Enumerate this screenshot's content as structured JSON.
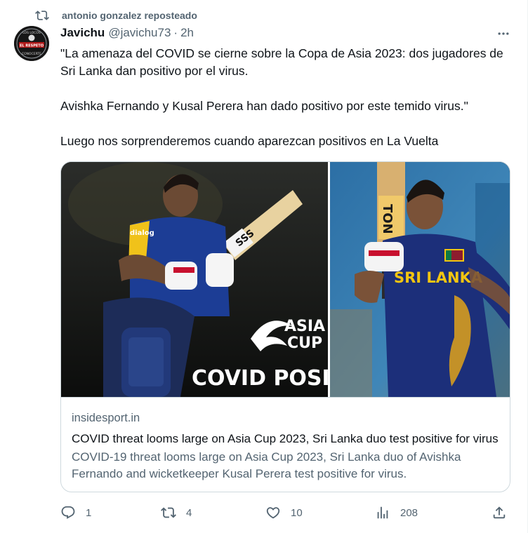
{
  "repost": {
    "label": "antonio gonzalez reposteado"
  },
  "author": {
    "name": "Javichu",
    "handle": "@javichu73",
    "separator": "·",
    "time": "2h"
  },
  "avatar_text": {
    "top": "LOS LOCOS",
    "middle": "EL RESPETO",
    "bottom": "CONOCERTE"
  },
  "tweet": {
    "lines": [
      "\"La amenaza del COVID se cierne sobre la Copa de Asia 2023: dos jugadores de Sri Lanka dan positivo por el virus.",
      "Avishka Fernando y Kusal Perera han dado positivo por este temido virus.\"",
      "Luego nos sorprenderemos cuando aparezcan positivos en La Vuelta"
    ]
  },
  "card": {
    "image_text": {
      "logo_line1": "ASIA",
      "logo_line2": "CUP",
      "banner": "COVID POSITIVE",
      "jersey_left": "SSS",
      "jersey_right": "SRI LANKA",
      "bat_text": "TON",
      "sponsor": "dialog"
    },
    "domain": "insidesport.in",
    "title": "COVID threat looms large on Asia Cup 2023, Sri Lanka duo test positive for virus",
    "description": "COVID-19 threat looms large on Asia Cup 2023, Sri Lanka duo of Avishka Fernando and wicketkeeper Kusal Perera test positive for virus."
  },
  "actions": {
    "replies": "1",
    "reposts": "4",
    "likes": "10",
    "views": "208"
  },
  "colors": {
    "text": "#0f1419",
    "secondary": "#536471",
    "border": "#cfd9de",
    "jersey": "#1c2f7a",
    "accent_yellow": "#f2c511"
  }
}
